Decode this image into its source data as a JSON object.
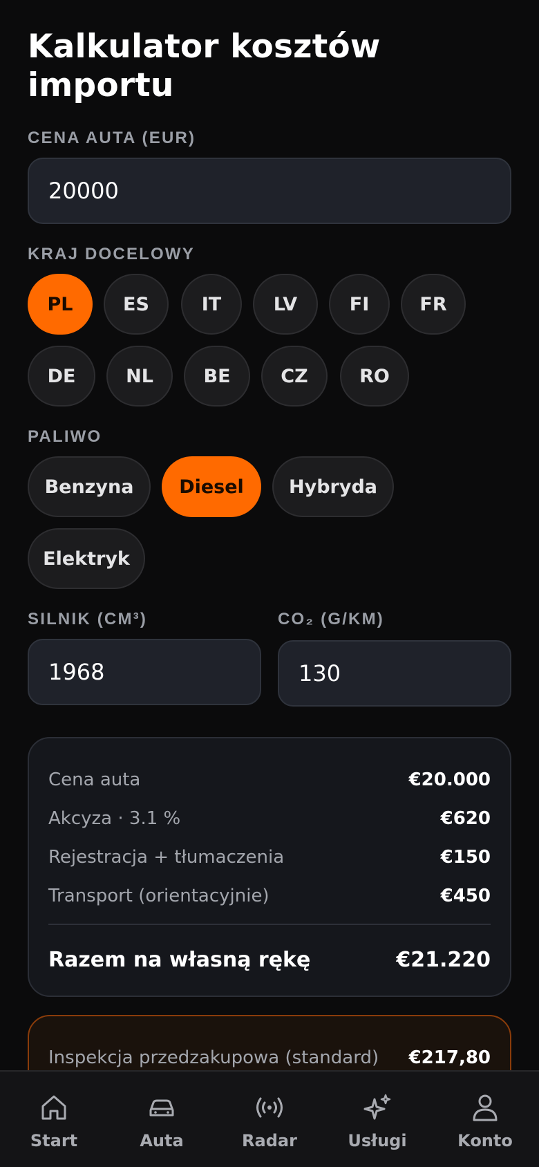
{
  "header": {
    "title": "Kalkulator kosztów importu"
  },
  "price": {
    "label": "CENA AUTA (EUR)",
    "value": "20000"
  },
  "country": {
    "label": "KRAJ DOCELOWY",
    "options": [
      "PL",
      "ES",
      "IT",
      "LV",
      "FI",
      "FR",
      "DE",
      "NL",
      "BE",
      "CZ",
      "RO"
    ],
    "selected": "PL"
  },
  "fuel": {
    "label": "PALIWO",
    "options": [
      "Benzyna",
      "Diesel",
      "Hybryda",
      "Elektryk"
    ],
    "selected": "Diesel"
  },
  "engine": {
    "label": "SILNIK (CM³)",
    "value": "1968"
  },
  "co2": {
    "label": "CO₂ (G/KM)",
    "value": "130"
  },
  "summary": {
    "rows": [
      {
        "label": "Cena auta",
        "value": "€20.000"
      },
      {
        "label": "Akcyza · 3.1 %",
        "value": "€620"
      },
      {
        "label": "Rejestracja + tłumaczenia",
        "value": "€150"
      },
      {
        "label": "Transport (orientacyjnie)",
        "value": "€450"
      }
    ],
    "total_label": "Razem na własną rękę",
    "total_value": "€21.220"
  },
  "services": {
    "rows": [
      {
        "label": "Inspekcja przedzakupowa (standard)",
        "value": "€217,80"
      }
    ]
  },
  "nav": {
    "items": [
      {
        "label": "Start",
        "icon": "home-icon"
      },
      {
        "label": "Auta",
        "icon": "car-icon"
      },
      {
        "label": "Radar",
        "icon": "radar-icon"
      },
      {
        "label": "Usługi",
        "icon": "sparkles-icon"
      },
      {
        "label": "Konto",
        "icon": "user-icon"
      }
    ]
  },
  "colors": {
    "accent": "#ff6a00",
    "background": "#0b0b0c",
    "card": "#15171c",
    "input": "#1f222a"
  }
}
